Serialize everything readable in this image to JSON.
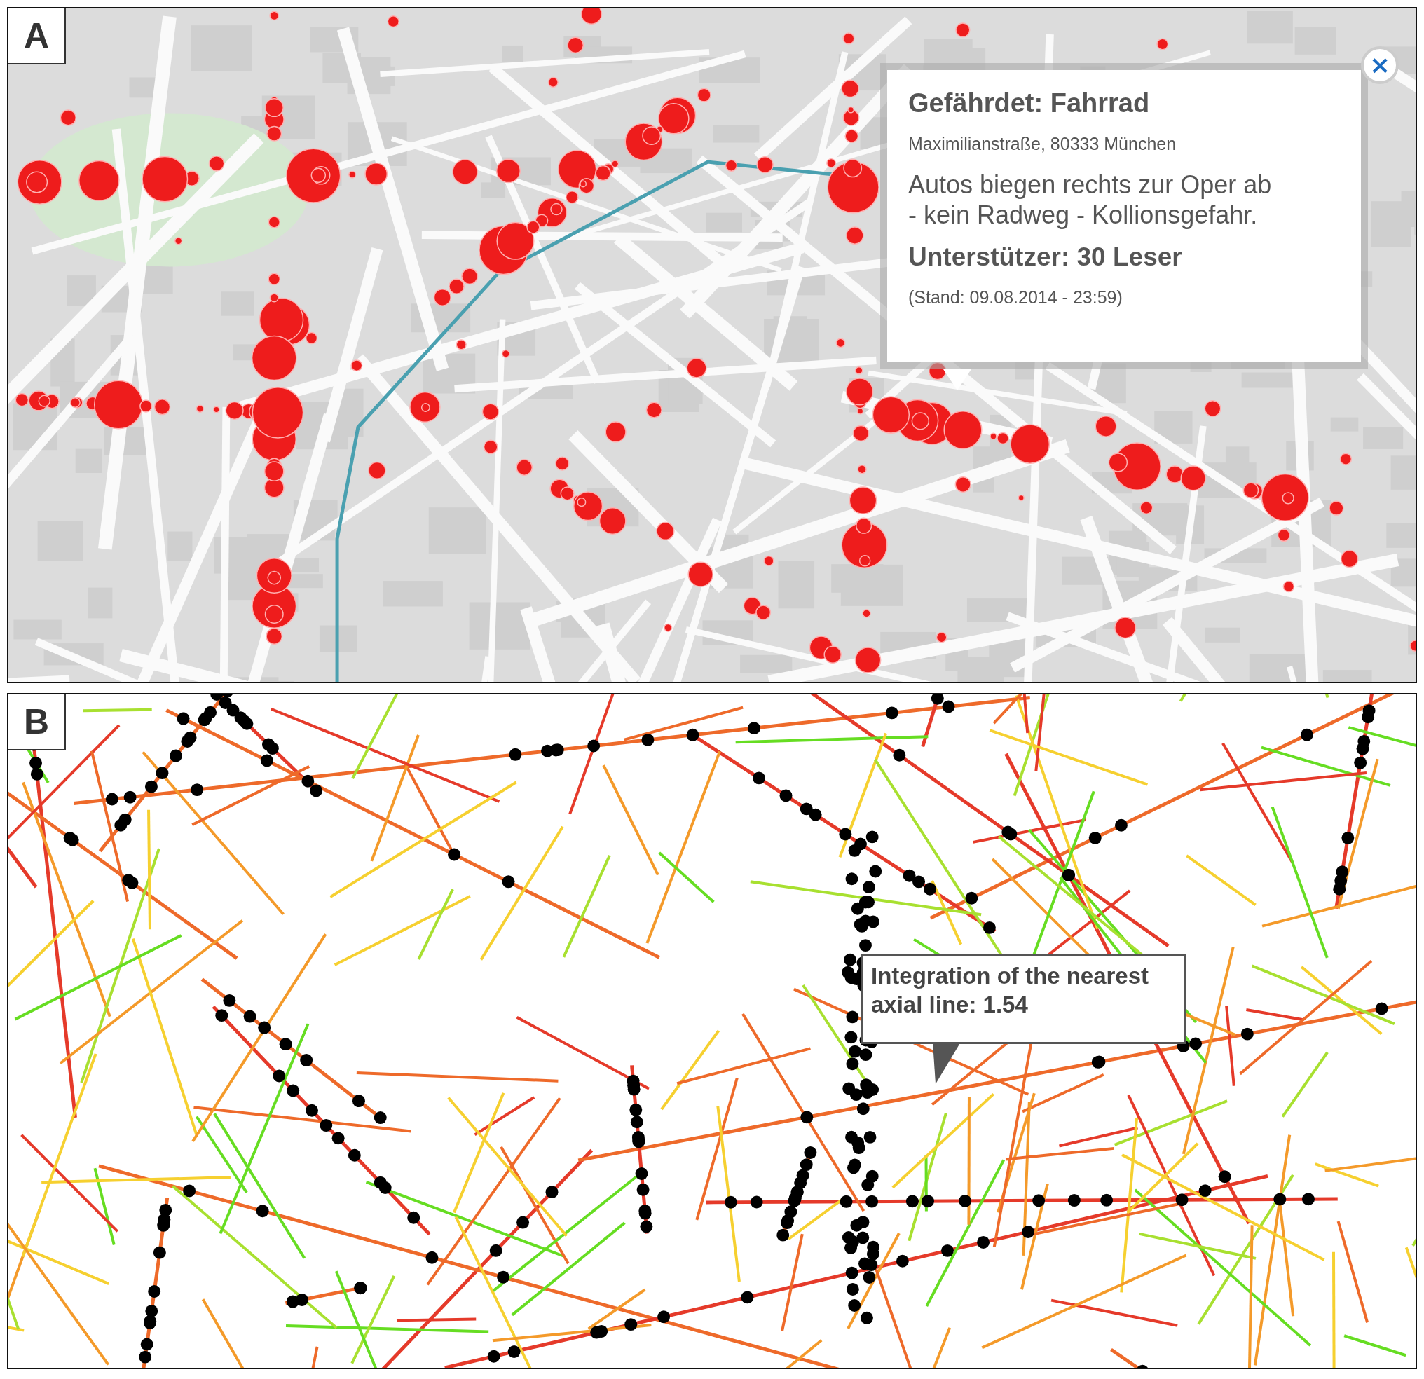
{
  "panels": [
    {
      "label": "A",
      "kind": "map",
      "popup": {
        "close": "×",
        "title": "Gefährdet: Fahrrad",
        "address": "Maximilianstraße, 80333 München",
        "description_lines": [
          "Autos biegen rechts zur Oper ab",
          "- kein Radweg - Kollionsgefahr."
        ],
        "supporters": "Unterstützer: 30 Leser",
        "timestamp": "(Stand: 09.08.2014 - 23:59)"
      }
    },
    {
      "label": "B",
      "kind": "axial",
      "tooltip": {
        "lines": [
          "Integration of the nearest",
          "axial line: 1.54"
        ]
      }
    }
  ]
}
